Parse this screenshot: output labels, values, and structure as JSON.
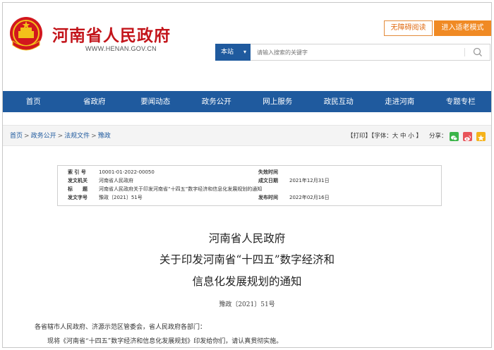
{
  "header": {
    "site_title": "河南省人民政府",
    "site_url": "WWW.HENAN.GOV.CN",
    "accessibility_label": "无障碍阅读",
    "elder_mode_label": "进入适老模式"
  },
  "search": {
    "scope_label": "本站",
    "placeholder": "请输入搜索的关键字"
  },
  "nav": {
    "items": [
      "首页",
      "省政府",
      "要闻动态",
      "政务公开",
      "网上服务",
      "政民互动",
      "走进河南",
      "专题专栏"
    ]
  },
  "breadcrumb": {
    "items": [
      "首页",
      "政务公开",
      "法规文件",
      "豫政"
    ],
    "separator": ">"
  },
  "tools": {
    "print_label": "【打印】",
    "font_label": "【字体：",
    "font_large": "大",
    "font_medium": "中",
    "font_small": "小",
    "font_close": "】",
    "share_label": "分享："
  },
  "meta": {
    "index_label": "索 引 号",
    "index_value": "10001-01-2022-00050",
    "expire_label": "失效时间",
    "expire_value": "",
    "issuer_label": "发文机关",
    "issuer_value": "河南省人民政府",
    "date_label": "成文日期",
    "date_value": "2021年12月31日",
    "subject_label": "标　　题",
    "subject_value": "河南省人民政府关于印发河南省“十四五”数字经济和信息化发展规划的通知",
    "docno_label": "发文字号",
    "docno_value": "豫政〔2021〕51号",
    "publish_label": "发布时间",
    "publish_value": "2022年02月16日"
  },
  "document": {
    "title_line1": "河南省人民政府",
    "title_line2": "关于印发河南省“十四五”数字经济和",
    "title_line3": "信息化发展规划的通知",
    "doc_number": "豫政〔2021〕51号",
    "salutation": "各省辖市人民政府、济源示范区管委会，省人民政府各部门：",
    "body_line1": "现将《河南省“十四五”数字经济和信息化发展规划》印发给你们，请认真贯彻实施。"
  },
  "colors": {
    "brand_red": "#c3151b",
    "nav_blue": "#1f5a9e",
    "accent_orange": "#f08a24"
  }
}
